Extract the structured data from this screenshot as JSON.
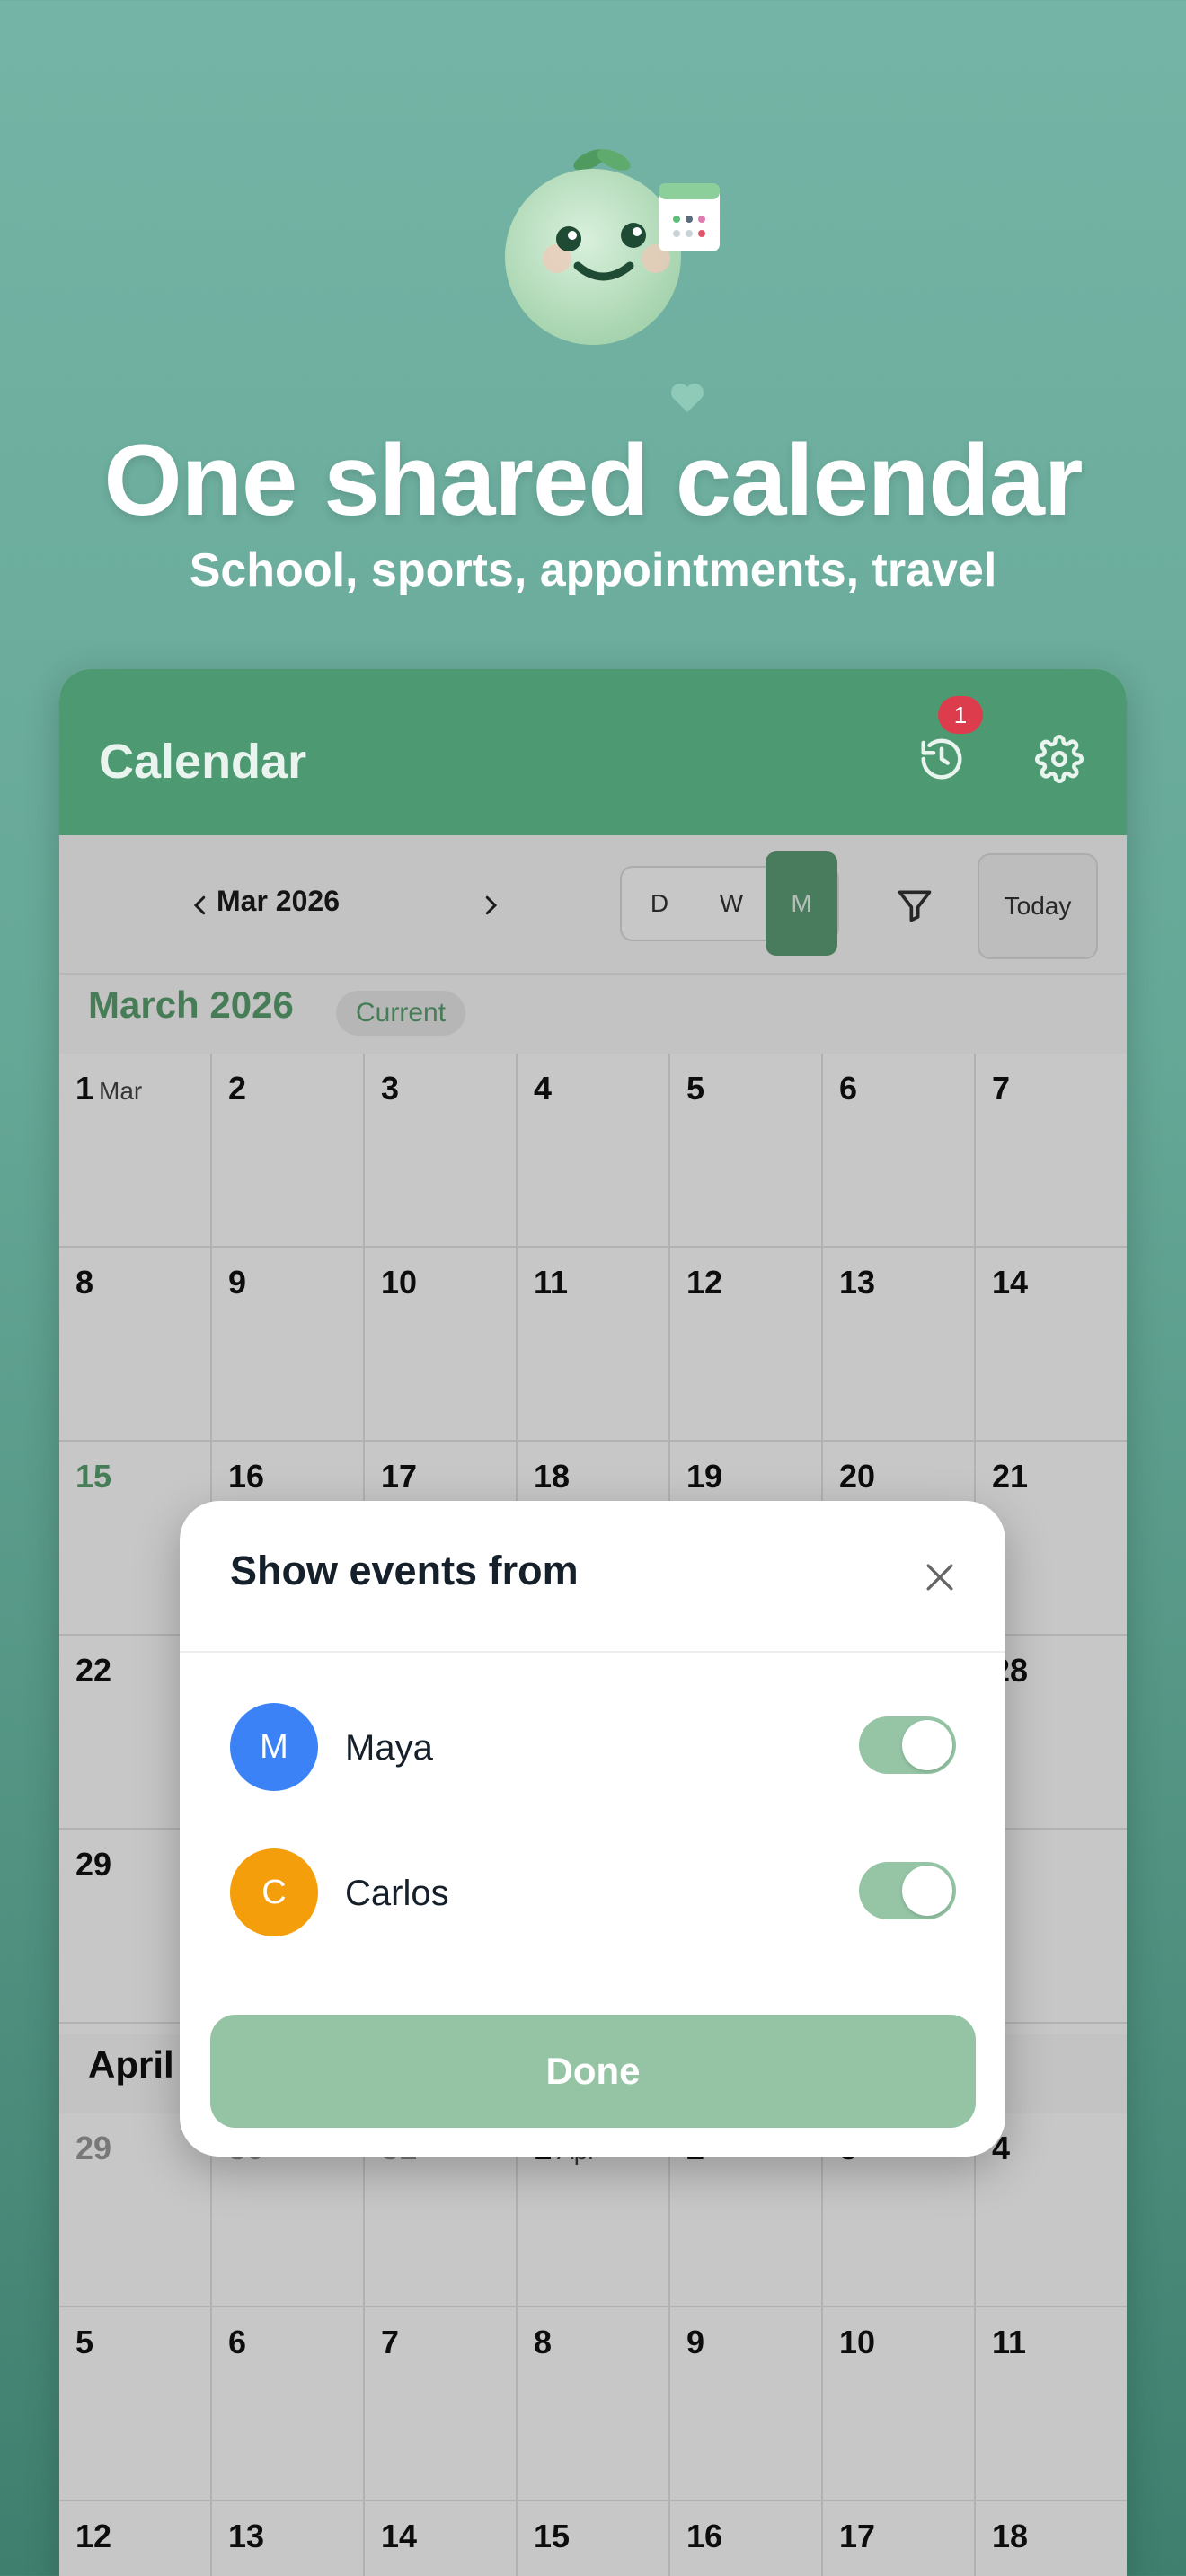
{
  "hero": {
    "title": "One shared calendar",
    "subtitle": "School, sports, appointments, travel"
  },
  "app": {
    "title": "Calendar",
    "history_badge": "1",
    "accent_color": "#4d9a72"
  },
  "toolbar": {
    "month_label": "Mar 2026",
    "view_modes": [
      "D",
      "W",
      "M"
    ],
    "active_view": "M",
    "today_label": "Today"
  },
  "months": [
    {
      "name": "March 2026",
      "badge": "Current",
      "weeks": [
        [
          {
            "d": "1",
            "sub": "Mar"
          },
          {
            "d": "2"
          },
          {
            "d": "3"
          },
          {
            "d": "4"
          },
          {
            "d": "5"
          },
          {
            "d": "6"
          },
          {
            "d": "7"
          }
        ],
        [
          {
            "d": "8"
          },
          {
            "d": "9"
          },
          {
            "d": "10"
          },
          {
            "d": "11"
          },
          {
            "d": "12"
          },
          {
            "d": "13"
          },
          {
            "d": "14"
          }
        ],
        [
          {
            "d": "15",
            "today": true
          },
          {
            "d": "16"
          },
          {
            "d": "17"
          },
          {
            "d": "18"
          },
          {
            "d": "19"
          },
          {
            "d": "20"
          },
          {
            "d": "21"
          }
        ],
        [
          {
            "d": "22"
          },
          {
            "d": ""
          },
          {
            "d": ""
          },
          {
            "d": ""
          },
          {
            "d": ""
          },
          {
            "d": ""
          },
          {
            "d": "28"
          }
        ],
        [
          {
            "d": "29"
          },
          {
            "d": ""
          },
          {
            "d": ""
          },
          {
            "d": ""
          },
          {
            "d": ""
          },
          {
            "d": ""
          },
          {
            "d": ""
          }
        ]
      ]
    },
    {
      "name": "April",
      "badge": "",
      "weeks": [
        [
          {
            "d": "29",
            "muted": true
          },
          {
            "d": "30",
            "muted": true
          },
          {
            "d": "31",
            "muted": true
          },
          {
            "d": "1",
            "sub": "Apr"
          },
          {
            "d": "2"
          },
          {
            "d": "3"
          },
          {
            "d": "4"
          }
        ],
        [
          {
            "d": "5"
          },
          {
            "d": "6"
          },
          {
            "d": "7"
          },
          {
            "d": "8"
          },
          {
            "d": "9"
          },
          {
            "d": "10"
          },
          {
            "d": "11"
          }
        ],
        [
          {
            "d": "12"
          },
          {
            "d": "13"
          },
          {
            "d": "14"
          },
          {
            "d": "15"
          },
          {
            "d": "16"
          },
          {
            "d": "17"
          },
          {
            "d": "18"
          }
        ]
      ]
    }
  ],
  "modal": {
    "title": "Show events from",
    "people": [
      {
        "initial": "M",
        "name": "Maya",
        "color": "#3b82f6",
        "enabled": true
      },
      {
        "initial": "C",
        "name": "Carlos",
        "color": "#f59e0b",
        "enabled": true
      }
    ],
    "done_label": "Done"
  }
}
